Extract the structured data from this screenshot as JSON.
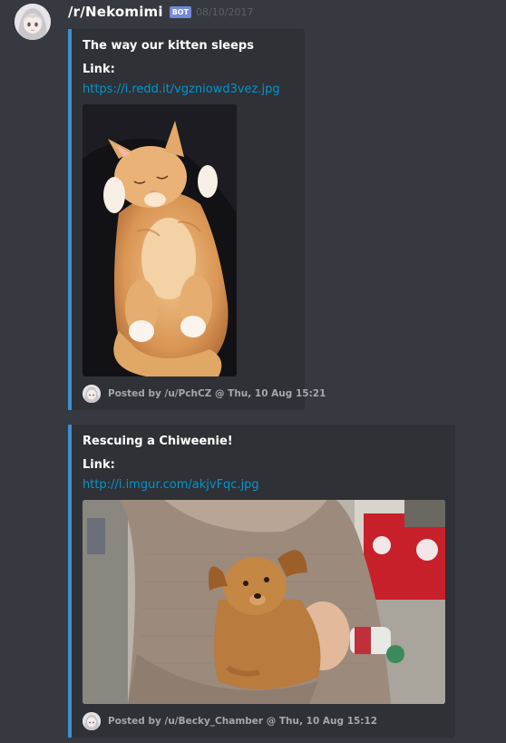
{
  "message": {
    "author": "/r/Nekomimi",
    "bot_tag": "BOT",
    "timestamp": "08/10/2017",
    "avatar_icon": "anime-girl-avatar-icon"
  },
  "embeds": [
    {
      "title": "The way our kitten sleeps",
      "link_label": "Link:",
      "link_url": "https://i.redd.it/vgzniowd3vez.jpg",
      "image_desc": "orange-kitten-sleeping-photo",
      "footer": "Posted by /u/PchCZ @ Thu, 10 Aug 15:21"
    },
    {
      "title": "Rescuing a Chiweenie!",
      "link_label": "Link:",
      "link_url": "http://i.imgur.com/akjvFqc.jpg",
      "image_desc": "person-holding-brown-puppy-photo",
      "footer": "Posted by /u/Becky_Chamber @ Thu, 10 Aug 15:12"
    }
  ],
  "colors": {
    "background": "#36393f",
    "embed_background": "#2f3136",
    "embed_accent": "#3d8dd3",
    "link": "#0096cf",
    "bot_tag": "#7289da",
    "timestamp": "#5d6067"
  }
}
